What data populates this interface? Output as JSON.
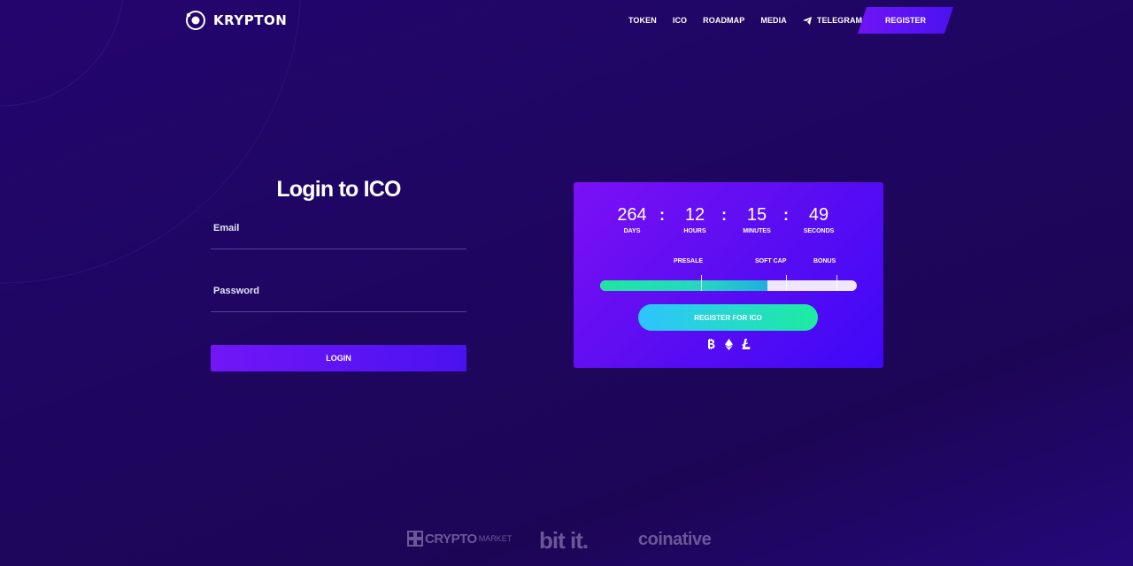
{
  "brand": {
    "name": "KRYPTON",
    "logo_icon": "orbit-logo-icon"
  },
  "nav": {
    "items": [
      {
        "label": "TOKEN"
      },
      {
        "label": "ICO"
      },
      {
        "label": "ROADMAP"
      },
      {
        "label": "MEDIA"
      },
      {
        "label": "TELEGRAM",
        "icon": "telegram-icon"
      }
    ],
    "register_label": "REGISTER"
  },
  "login": {
    "title": "Login to ICO",
    "email_label": "Email",
    "email_value": "",
    "password_label": "Password",
    "password_value": "",
    "button_label": "LOGIN"
  },
  "ico": {
    "countdown": [
      {
        "value": "264",
        "label": "DAYS"
      },
      {
        "value": "12",
        "label": "HOURS"
      },
      {
        "value": "15",
        "label": "MINUTES"
      },
      {
        "value": "49",
        "label": "SECONDS"
      }
    ],
    "separator": ":",
    "milestones": [
      "PRESALE",
      "SOFT CAP",
      "BONUS"
    ],
    "progress_fraction": 0.65,
    "button_label": "REGISTER FOR ICO",
    "coins": [
      "bitcoin-icon",
      "ethereum-icon",
      "litecoin-icon"
    ]
  },
  "partners": {
    "items": [
      {
        "name": "CRYPTO",
        "suffix": "MARKET"
      },
      {
        "name": "bit it."
      },
      {
        "name": "coinative"
      }
    ]
  },
  "colors": {
    "background": "#1e0660",
    "accent_purple": "#6f14f5",
    "accent_blue": "#4a12f0",
    "progress_green": "#1fe5a0",
    "button_cyan": "#2ec3ff",
    "partner_grey": "#6b5798"
  }
}
